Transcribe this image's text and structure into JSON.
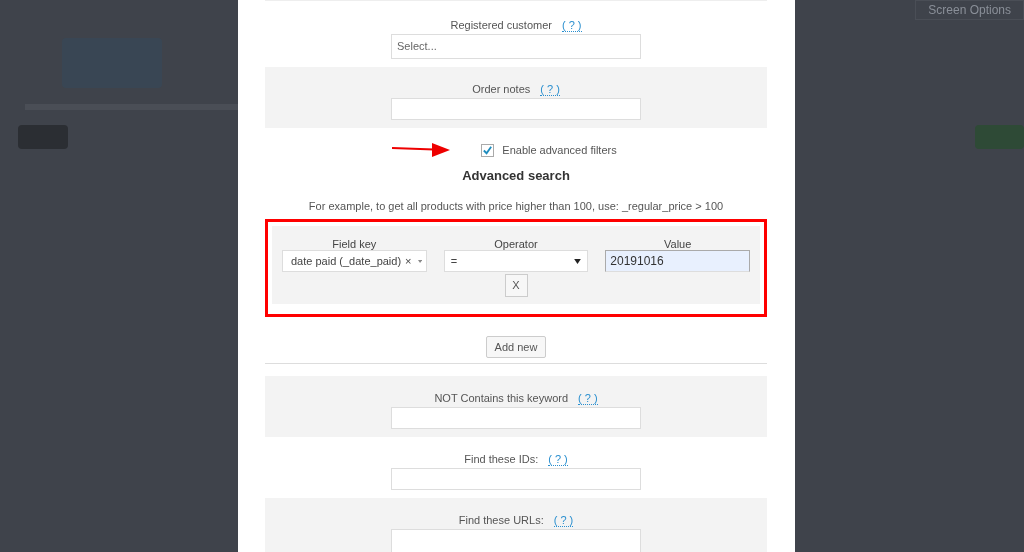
{
  "background_page": {
    "screen_options_button": "Screen Options"
  },
  "modal": {
    "fields_top": [
      {
        "kind": "select",
        "label": "Registered customer",
        "help": "( ? )",
        "placeholder": "Select...",
        "shaded": false
      },
      {
        "kind": "input",
        "label": "Order notes",
        "help": "( ? )",
        "shaded": true
      }
    ],
    "advanced_toggle": {
      "label": "Enable advanced filters",
      "checked": true
    },
    "advanced": {
      "title": "Advanced search",
      "hint": "For example, to get all products with price higher than 100, use: _regular_price > 100",
      "columns": [
        "Field key",
        "Operator",
        "Value"
      ],
      "rows": [
        {
          "field_key": "date paid (_date_paid)",
          "clear": "×",
          "operator": "=",
          "value": "20191016",
          "remove": "X"
        }
      ],
      "add_button": "Add new"
    },
    "fields_bottom": [
      {
        "kind": "input",
        "label": "NOT Contains this keyword",
        "help": "( ? )",
        "shaded": true
      },
      {
        "kind": "input",
        "label": "Find these IDs:",
        "help": "( ? )",
        "shaded": false
      },
      {
        "kind": "textarea",
        "label": "Find these URLs:",
        "help": "( ? )",
        "shaded": true
      }
    ]
  }
}
